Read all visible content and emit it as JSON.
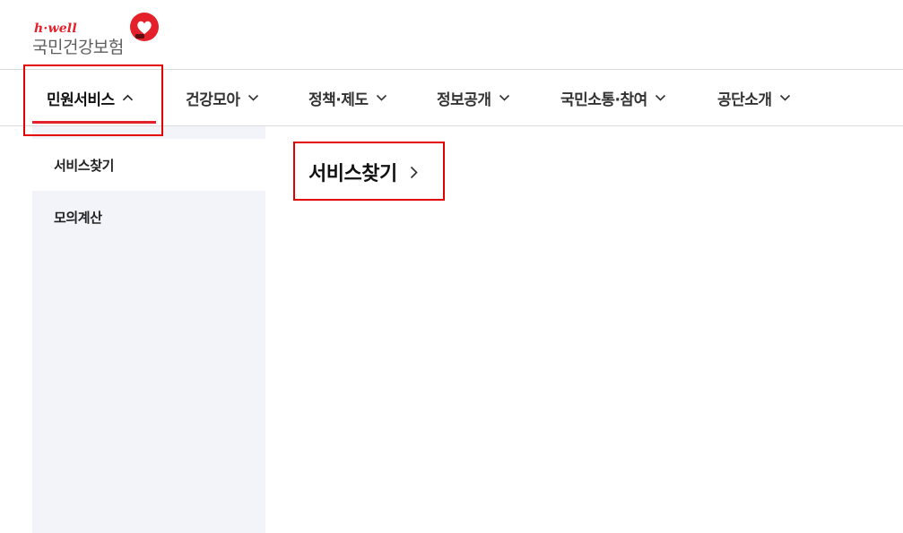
{
  "logo": {
    "tagline": "h·well",
    "name": "국민건강보험",
    "icon": "heart-logo-icon",
    "accent_color": "#e4212b"
  },
  "nav": {
    "items": [
      {
        "label": "민원서비스",
        "icon": "chevron-up-icon",
        "active": true
      },
      {
        "label": "건강모아",
        "icon": "chevron-down-icon"
      },
      {
        "label": "정책·제도",
        "icon": "chevron-down-icon"
      },
      {
        "label": "정보공개",
        "icon": "chevron-down-icon"
      },
      {
        "label": "국민소통·참여",
        "icon": "chevron-down-icon"
      },
      {
        "label": "공단소개",
        "icon": "chevron-down-icon"
      }
    ]
  },
  "submenu": {
    "items": [
      {
        "label": "서비스찾기",
        "selected": true
      },
      {
        "label": "모의계산"
      }
    ]
  },
  "detail": {
    "title": "서비스찾기",
    "icon": "chevron-right-icon"
  },
  "highlight_color": "#e20000"
}
